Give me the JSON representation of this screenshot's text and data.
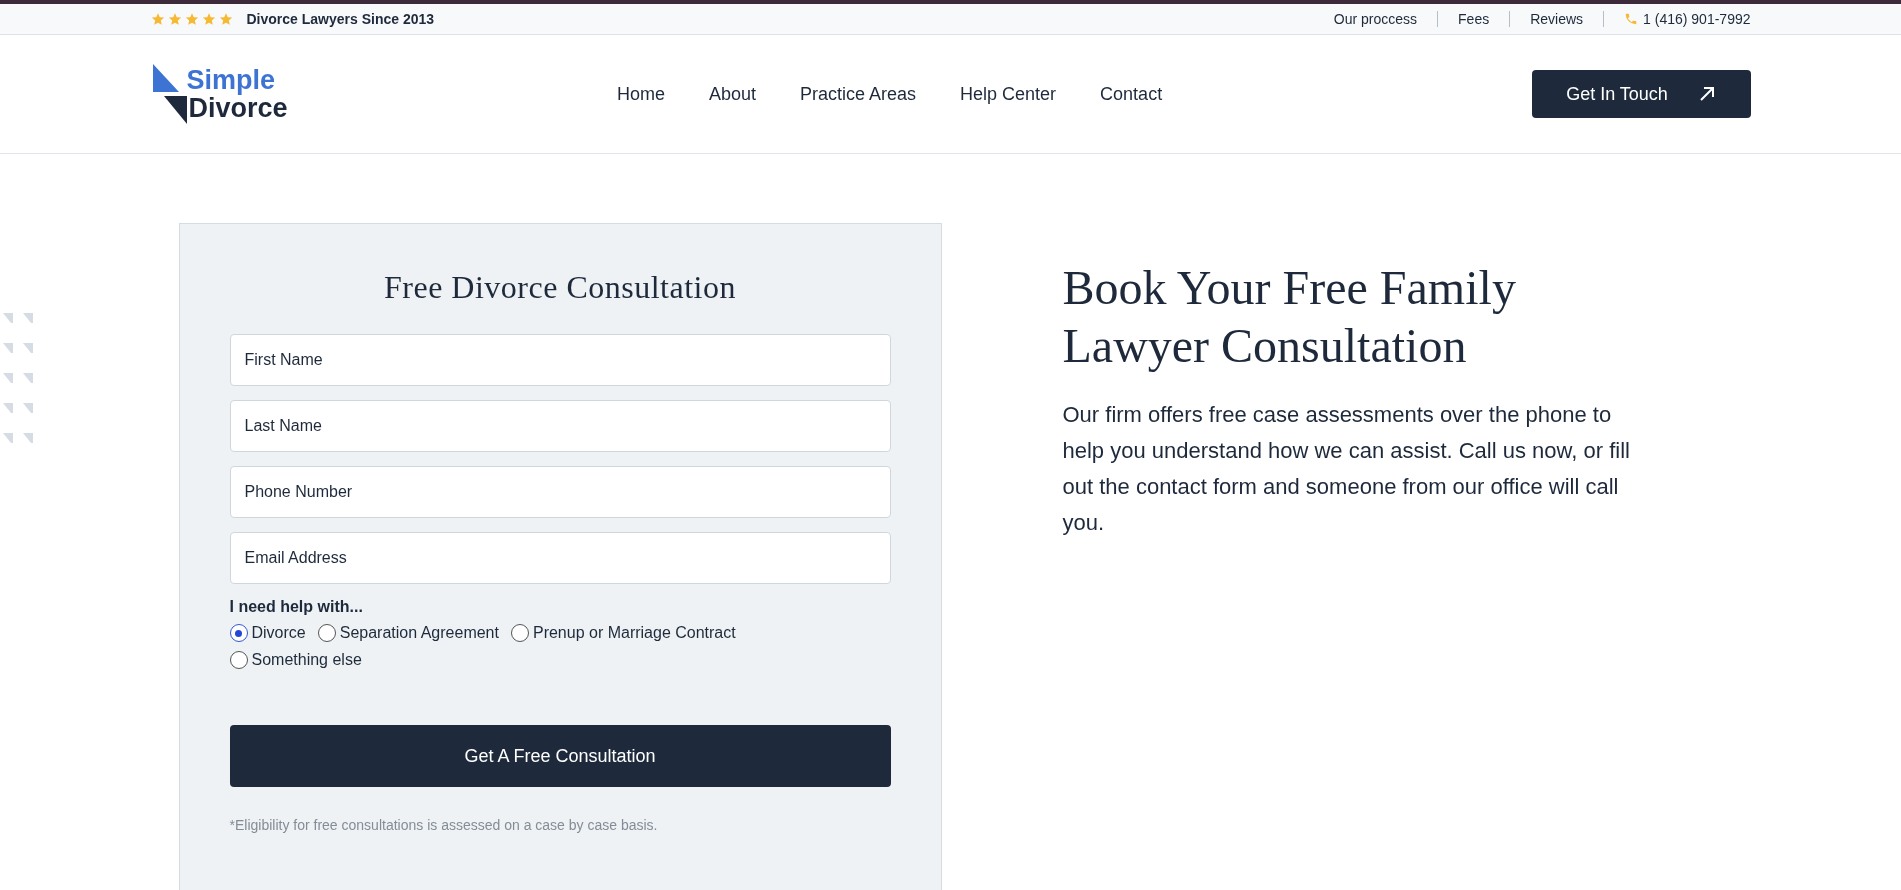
{
  "top_bar": {
    "stars": 5,
    "tagline": "Divorce Lawyers Since 2013",
    "links": [
      "Our proccess",
      "Fees",
      "Reviews"
    ],
    "phone": "1 (416) 901-7992"
  },
  "header": {
    "logo": {
      "line1": "Simple",
      "line2": "Divorce"
    },
    "nav": [
      "Home",
      "About",
      "Practice Areas",
      "Help Center",
      "Contact"
    ],
    "cta": "Get In Touch"
  },
  "form": {
    "title": "Free Divorce Consultation",
    "fields": [
      {
        "placeholder": "First Name"
      },
      {
        "placeholder": "Last Name"
      },
      {
        "placeholder": "Phone Number"
      },
      {
        "placeholder": "Email Address"
      }
    ],
    "question": "I need help with...",
    "options": [
      {
        "label": "Divorce",
        "selected": true
      },
      {
        "label": "Separation Agreement",
        "selected": false
      },
      {
        "label": "Prenup or Marriage Contract",
        "selected": false
      },
      {
        "label": "Something else",
        "selected": false
      }
    ],
    "submit": "Get A Free Consultation",
    "note": "*Eligibility for free consultations is assessed on a case by case basis."
  },
  "intro": {
    "heading": "Book Your Free Family Lawyer Consultation",
    "body": "Our firm offers free case assessments over the phone to help you understand how we can assist. Call us now, or fill out the contact form and someone from our office will call you."
  }
}
